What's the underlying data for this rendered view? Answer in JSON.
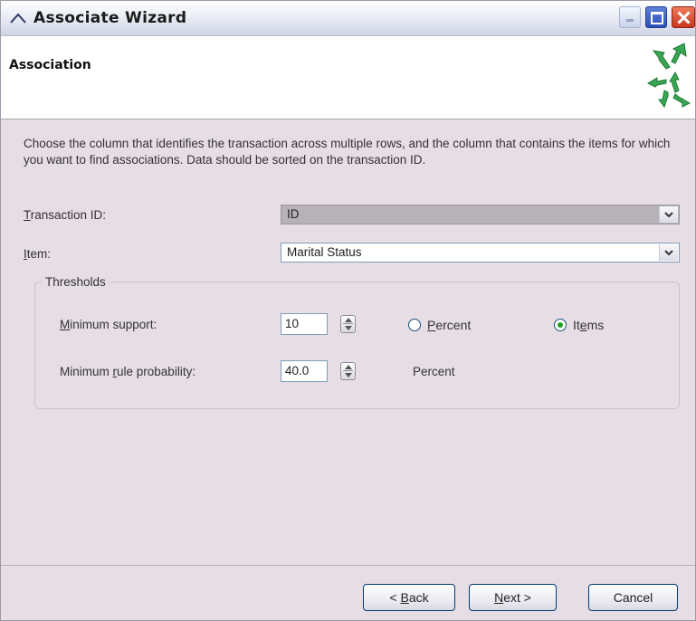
{
  "window": {
    "title": "Associate Wizard"
  },
  "header": {
    "title": "Association"
  },
  "instructions": "Choose the column that identifies the transaction across multiple rows, and the column that contains the items for which you want to find associations. Data should be sorted on the transaction ID.",
  "fields": {
    "transaction_id": {
      "label_mnemonic": "T",
      "label_rest": "ransaction ID:",
      "value": "ID"
    },
    "item": {
      "label_mnemonic": "I",
      "label_rest": "tem:",
      "value": "Marital Status"
    }
  },
  "thresholds": {
    "title": "Thresholds",
    "min_support": {
      "label_mnemonic": "M",
      "label_rest": "inimum support:",
      "value": "10"
    },
    "min_rule_probability": {
      "label_pre": "Minimum ",
      "label_mnemonic": "r",
      "label_rest": "ule probability:",
      "value": "40.0",
      "unit": "Percent"
    },
    "percent_radio": {
      "label_mnemonic": "P",
      "label_rest": "ercent",
      "checked": false
    },
    "items_radio": {
      "label_pre": "It",
      "label_mnemonic": "e",
      "label_rest": "ms",
      "checked": true
    }
  },
  "buttons": {
    "back_pre": "< ",
    "back_mnemonic": "B",
    "back_rest": "ack",
    "next_mnemonic": "N",
    "next_rest": "ext >",
    "cancel": "Cancel"
  },
  "icons": {
    "title": "caret-up-icon",
    "header": "green-arrows-icon",
    "dropdown": "chevron-down-icon",
    "spinner": "spin-arrows-icon"
  }
}
